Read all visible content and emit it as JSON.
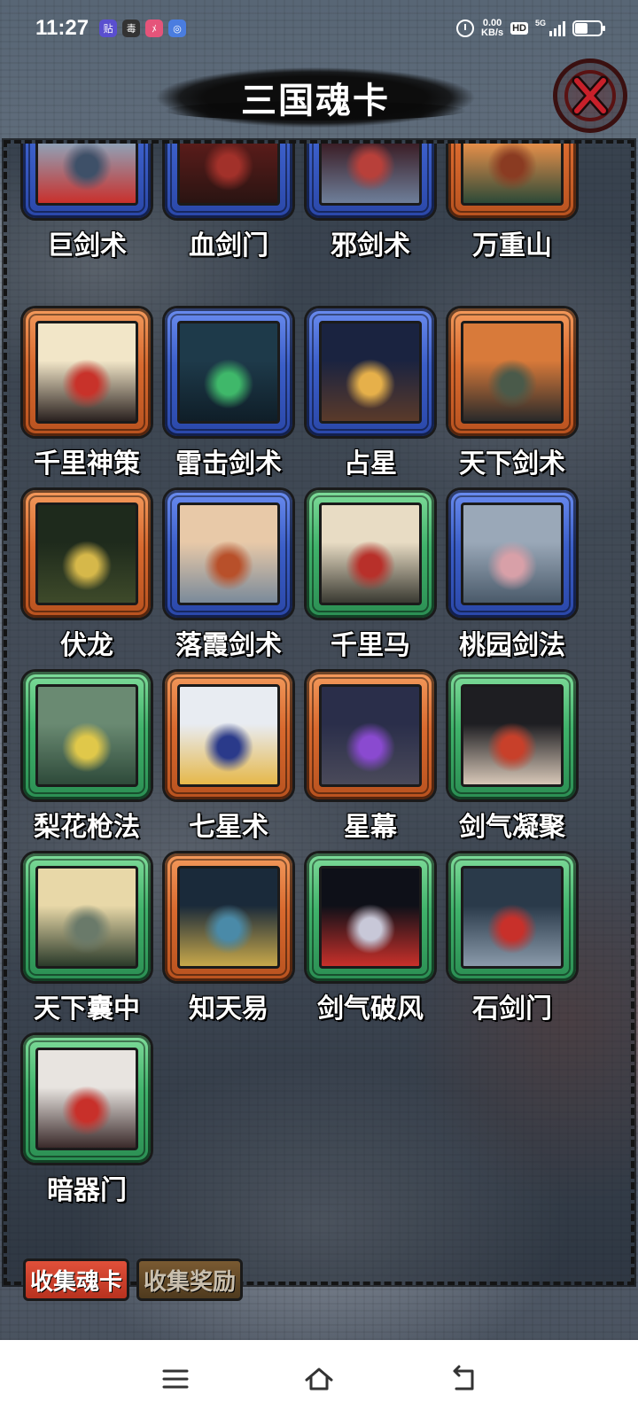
{
  "status_bar": {
    "time": "11:27",
    "app_icons": [
      {
        "name": "app-notify-icon-1",
        "glyph": "贴",
        "color": "#5a4fcf"
      },
      {
        "name": "app-notify-icon-2",
        "glyph": "毒",
        "color": "#333333"
      },
      {
        "name": "app-notify-icon-3",
        "glyph": "ﾒ",
        "color": "#e5547a"
      },
      {
        "name": "app-notify-icon-4",
        "glyph": "◎",
        "color": "#4a7de0"
      }
    ],
    "net_speed_value": "0.00",
    "net_speed_unit": "KB/s",
    "hd_label": "HD",
    "network_label": "5G"
  },
  "header": {
    "title": "三国魂卡"
  },
  "cards": [
    {
      "label": "巨剑术",
      "rarity": "blue",
      "art": [
        "#8fa3b8",
        "#3e5068",
        "#c9302c"
      ]
    },
    {
      "label": "血剑门",
      "rarity": "blue",
      "art": [
        "#5a1c1a",
        "#a2312a",
        "#2a1412"
      ]
    },
    {
      "label": "邪剑术",
      "rarity": "blue",
      "art": [
        "#3a1c24",
        "#b8403a",
        "#6e7f9a"
      ]
    },
    {
      "label": "万重山",
      "rarity": "orange",
      "art": [
        "#e8904a",
        "#8a3b22",
        "#2d4a38"
      ]
    },
    {
      "label": "千里神策",
      "rarity": "orange",
      "art": [
        "#f2e6c8",
        "#c8322a",
        "#2b2220"
      ]
    },
    {
      "label": "雷击剑术",
      "rarity": "blue",
      "art": [
        "#1e3a4a",
        "#3fb86a",
        "#0f1e28"
      ]
    },
    {
      "label": "占星",
      "rarity": "blue",
      "art": [
        "#1a2340",
        "#e6b04a",
        "#5a3a2a"
      ]
    },
    {
      "label": "天下剑术",
      "rarity": "orange",
      "art": [
        "#d87a3a",
        "#4a5a4a",
        "#2a2a2a"
      ]
    },
    {
      "label": "伏龙",
      "rarity": "orange",
      "art": [
        "#1e2a1c",
        "#d6b84a",
        "#3e4a2a"
      ]
    },
    {
      "label": "落霞剑术",
      "rarity": "blue",
      "art": [
        "#e8c9a8",
        "#b8502a",
        "#7a8a9a"
      ]
    },
    {
      "label": "千里马",
      "rarity": "green",
      "art": [
        "#e8dcc4",
        "#b8302a",
        "#3a3a32"
      ]
    },
    {
      "label": "桃园剑法",
      "rarity": "blue",
      "art": [
        "#9aa8b8",
        "#d8a0a8",
        "#4a5a6a"
      ]
    },
    {
      "label": "梨花枪法",
      "rarity": "green",
      "art": [
        "#6a8a72",
        "#e0c84a",
        "#2e4a3a"
      ]
    },
    {
      "label": "七星术",
      "rarity": "orange",
      "art": [
        "#e8ecf2",
        "#2a3a8a",
        "#e6b84a"
      ]
    },
    {
      "label": "星幕",
      "rarity": "orange",
      "art": [
        "#2a2e4a",
        "#8a4ad0",
        "#4a4a5a"
      ]
    },
    {
      "label": "剑气凝聚",
      "rarity": "green",
      "art": [
        "#1e1e22",
        "#c8402a",
        "#d8c8b8"
      ]
    },
    {
      "label": "天下囊中",
      "rarity": "green",
      "art": [
        "#e8d8a8",
        "#6a7a6a",
        "#2a3a2a"
      ]
    },
    {
      "label": "知天易",
      "rarity": "orange",
      "art": [
        "#1a2a3a",
        "#4a8aa8",
        "#c8a84a"
      ]
    },
    {
      "label": "剑气破风",
      "rarity": "green",
      "art": [
        "#0e1018",
        "#c8c8d8",
        "#c8302a"
      ]
    },
    {
      "label": "石剑门",
      "rarity": "green",
      "art": [
        "#2a3a4a",
        "#c8302a",
        "#8a9aaa"
      ]
    },
    {
      "label": "暗器门",
      "rarity": "green",
      "art": [
        "#e8e4e0",
        "#c8302a",
        "#3a2a2a"
      ]
    }
  ],
  "tabs": {
    "collect_cards": "收集魂卡",
    "collect_rewards": "收集奖励"
  },
  "colors": {
    "blue_frame": "#3b5ec8",
    "orange_frame": "#d8692e",
    "green_frame": "#3fb26a",
    "tab_active": "#c8382a",
    "tab_inactive": "#5a4226"
  }
}
